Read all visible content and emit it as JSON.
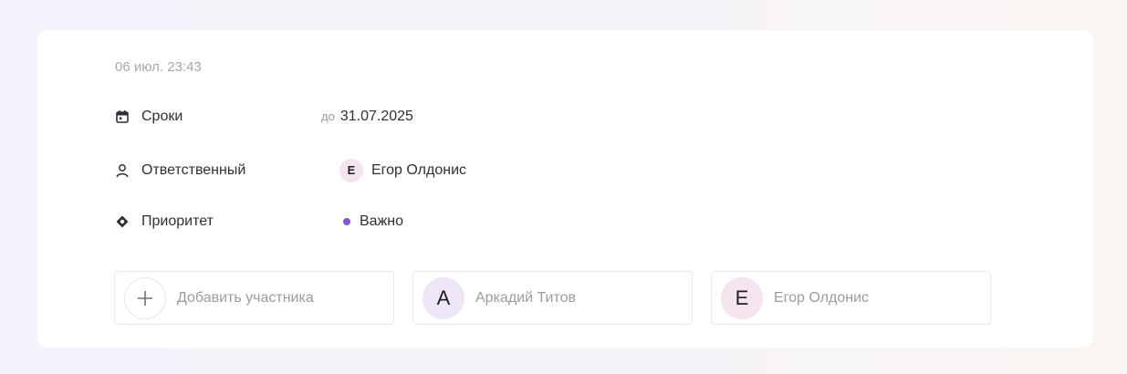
{
  "timestamp": "06 июл. 23:43",
  "deadline": {
    "label": "Сроки",
    "prefix": "до",
    "date": "31.07.2025",
    "icon": "calendar-icon"
  },
  "owner": {
    "label": "Ответственный",
    "initial": "Е",
    "name": "Егор Олдонис",
    "icon": "person-icon"
  },
  "priority": {
    "label": "Приоритет",
    "value": "Важно",
    "color": "#8a54d9",
    "icon": "diamond-icon"
  },
  "members": {
    "add": {
      "label": "Добавить участника",
      "icon": "plus-icon"
    },
    "items": [
      {
        "initial": "А",
        "name": "Аркадий Титов",
        "color": "#ece6f7"
      },
      {
        "initial": "Е",
        "name": "Егор Олдонис",
        "color": "#f3e4ee"
      }
    ]
  }
}
